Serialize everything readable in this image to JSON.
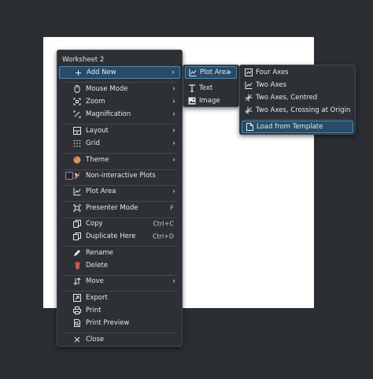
{
  "worksheet_menu": {
    "title": "Worksheet 2",
    "items": {
      "add_new": "Add New",
      "mouse_mode": "Mouse Mode",
      "zoom": "Zoom",
      "magnification": "Magnification",
      "layout": "Layout",
      "grid": "Grid",
      "theme": "Theme",
      "non_interactive": "Non-interactive Plots",
      "plot_area": "Plot Area",
      "presenter_mode": "Presenter Mode",
      "presenter_shortcut": "F",
      "copy": "Copy",
      "copy_shortcut": "Ctrl+C",
      "duplicate_here": "Duplicate Here",
      "duplicate_shortcut": "Ctrl+D",
      "rename": "Rename",
      "delete": "Delete",
      "move": "Move",
      "export": "Export",
      "print": "Print",
      "print_preview": "Print Preview",
      "close": "Close"
    }
  },
  "add_new_menu": {
    "items": {
      "plot_area": "Plot Area",
      "text": "Text",
      "image": "Image"
    }
  },
  "plot_area_menu": {
    "items": {
      "four_axes": "Four Axes",
      "two_axes": "Two Axes",
      "two_axes_centred": "Two Axes, Centred",
      "two_axes_origin": "Two Axes, Crossing at Origin",
      "load_template": "Load from Template"
    }
  },
  "colors": {
    "background": "#2a2d32",
    "menu_bg": "#2d3035",
    "highlight": "#284c68",
    "highlight_border": "#3d8fc7",
    "delete_red": "#e0534f",
    "theme_orange": "#e8943a"
  }
}
